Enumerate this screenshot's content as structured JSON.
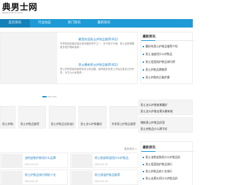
{
  "header": {
    "logo": "典男士网",
    "logo_url": "www.x8912.com"
  },
  "nav": {
    "items": [
      "首页资讯",
      "行业动态",
      "热门资讯",
      "最新资讯"
    ],
    "active_index": 0
  },
  "featured": {
    "title1": "最受欢迎男士护肤品推荐(8月)",
    "text1": "冬季是皮肤最容易出现问题的季节之一，天气寒冷干燥，男士皮肤需要更多的护理和保养...",
    "title2": "男士最新男士护肤品推荐(8月)",
    "text2": "男士护肤是越来越受到关注的话题，越来越多的男士开始注重自己的外表，本文为大家推荐..."
  },
  "grid": {
    "items": [
      "男士护肤的必备步骤",
      "男士护肤品推荐",
      "男士护肤品怎样选择",
      "男士怎么护肤最好",
      "冬季男士护肤品推荐"
    ]
  },
  "section": {
    "more_link": "更多资讯 >"
  },
  "list": {
    "items": [
      {
        "title": "油性皮肤护肤用什么品牌",
        "date": "2022-03-29"
      },
      {
        "title": "男士脸部保湿用什么护肤品",
        "date": "2022-03-29"
      },
      {
        "title": "男士护肤品排行榜前十名",
        "date": "2022-03-29"
      },
      {
        "title": "男士保湿护肤品推荐",
        "date": "2022-03-29"
      }
    ]
  },
  "sidebar": {
    "box1_heading": "最新资讯",
    "box1_links": [
      "最好的男士护肤品推荐介绍",
      "男士油皮用什么护肤品",
      "男士痘痘肌护肤品排行榜",
      "男士护肤品牌推荐",
      "男士护肤的正确步骤"
    ],
    "strip_links": [
      "男士怎么护肤效果最好",
      "男士怎么护肤去黑头最有效",
      "哪款男士护肤品好用",
      "男士护肤品什么牌子好"
    ],
    "box2_heading": "最新资讯",
    "box2_links": [
      "男士油性皮肤用什么护肤品好",
      "男士痘痘肌护肤品排行",
      "男士护肤品前十名排行",
      "男士去黑头用什么护肤品好"
    ]
  },
  "colors": {
    "accent": "#1e9ad6",
    "nav_active": "#1481b8",
    "link": "#1e7fc2"
  }
}
